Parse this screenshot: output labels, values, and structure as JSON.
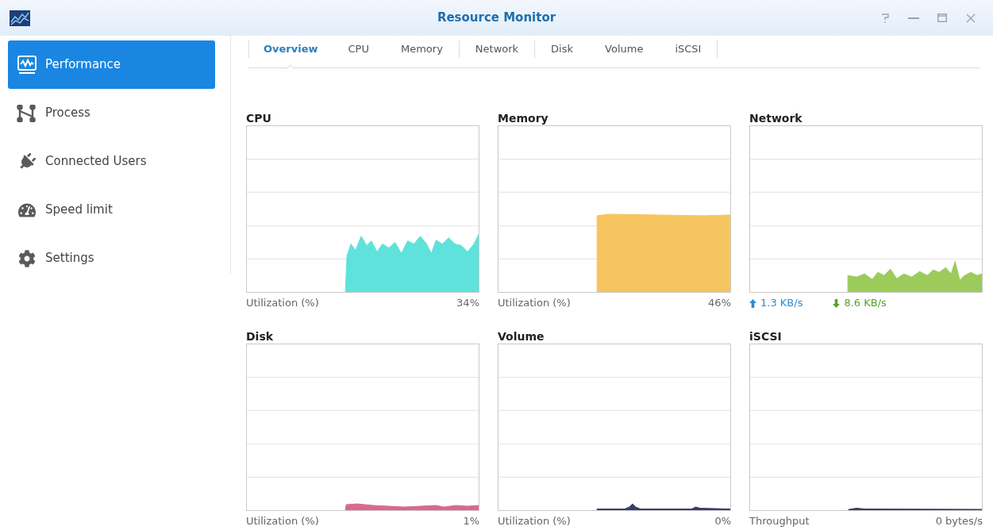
{
  "window": {
    "title": "Resource Monitor"
  },
  "sidebar": {
    "items": [
      {
        "label": "Performance",
        "selected": true
      },
      {
        "label": "Process",
        "selected": false
      },
      {
        "label": "Connected Users",
        "selected": false
      },
      {
        "label": "Speed limit",
        "selected": false
      },
      {
        "label": "Settings",
        "selected": false
      }
    ]
  },
  "tabs": [
    {
      "label": "Overview",
      "selected": true
    },
    {
      "label": "CPU",
      "selected": false
    },
    {
      "label": "Memory",
      "selected": false
    },
    {
      "label": "Network",
      "selected": false
    },
    {
      "label": "Disk",
      "selected": false
    },
    {
      "label": "Volume",
      "selected": false
    },
    {
      "label": "iSCSI",
      "selected": false
    }
  ],
  "charts": [
    {
      "title": "CPU",
      "color": "#5fe2dc",
      "footer": {
        "kind": "reading",
        "label": "Utilization (%)",
        "value": "34%"
      }
    },
    {
      "title": "Memory",
      "color": "#f6c55f",
      "footer": {
        "kind": "reading",
        "label": "Utilization (%)",
        "value": "46%"
      }
    },
    {
      "title": "Network",
      "color": "#9ccb5c",
      "footer": {
        "kind": "transfer",
        "upload": "1.3 KB/s",
        "download": "8.6 KB/s"
      }
    },
    {
      "title": "Disk",
      "color": "#d9688f",
      "footer": {
        "kind": "reading",
        "label": "Utilization (%)",
        "value": "1%"
      }
    },
    {
      "title": "Volume",
      "color": "#3a3d6b",
      "footer": {
        "kind": "reading",
        "label": "Utilization (%)",
        "value": "0%"
      }
    },
    {
      "title": "iSCSI",
      "color": "#3a3f5c",
      "footer": {
        "kind": "reading",
        "label": "Throughput",
        "value": "0 bytes/s"
      }
    }
  ]
}
